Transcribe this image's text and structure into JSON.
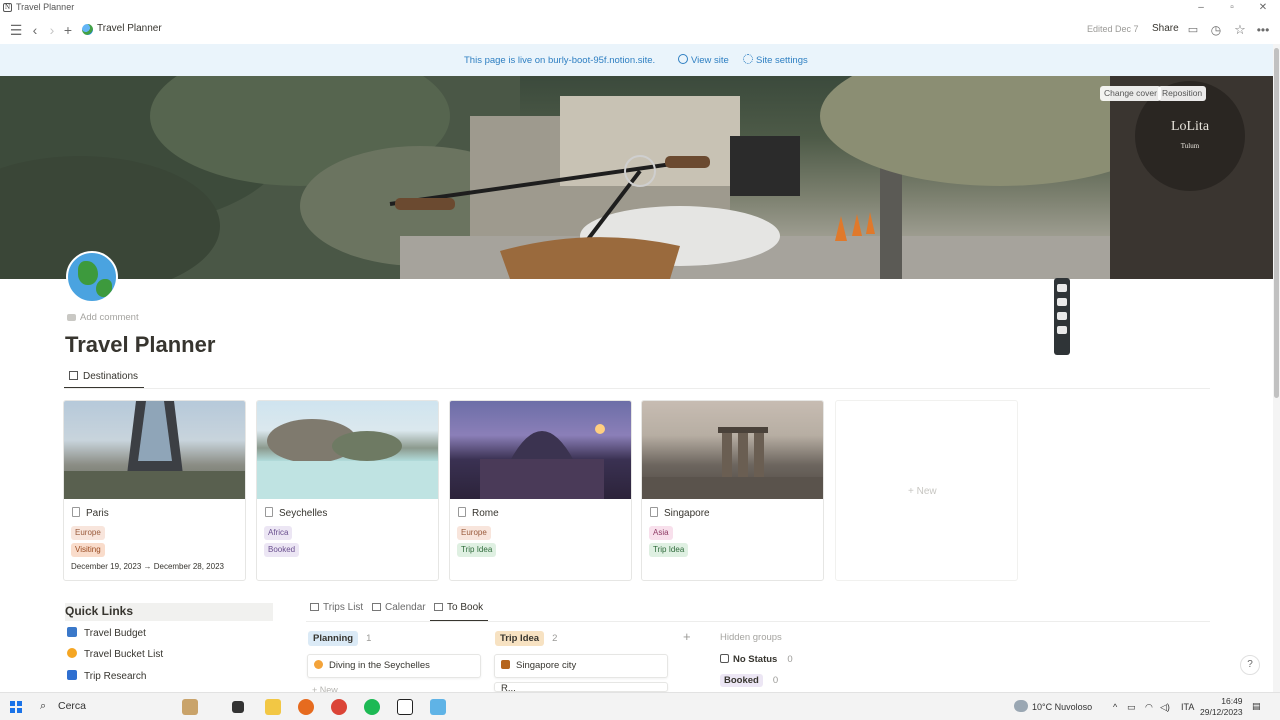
{
  "window": {
    "title": "Travel Planner",
    "app_glyph": "N"
  },
  "topbar": {
    "breadcrumb": "Travel Planner",
    "edited": "Edited Dec 7",
    "share": "Share"
  },
  "banner": {
    "live_text": "This page is live on burly-boot-95f.notion.site.",
    "view_site": "View site",
    "site_settings": "Site settings"
  },
  "cover": {
    "change_cover": "Change cover",
    "reposition": "Reposition"
  },
  "page": {
    "add_comment": "Add comment",
    "title": "Travel Planner"
  },
  "gallery": {
    "tab": "Destinations",
    "new_label": "+ New",
    "cards": [
      {
        "name": "Paris",
        "tags": [
          {
            "text": "Europe",
            "bg": "#f8e5dc",
            "fg": "#9a5b3c"
          },
          {
            "text": "Visiting",
            "bg": "#f9dccb",
            "fg": "#9a4a20"
          }
        ],
        "dates": "December 19, 2023 → December 28, 2023"
      },
      {
        "name": "Seychelles",
        "tags": [
          {
            "text": "Africa",
            "bg": "#ece6f4",
            "fg": "#6a4f8f"
          },
          {
            "text": "Booked",
            "bg": "#ece6f4",
            "fg": "#6a4f8f"
          }
        ],
        "dates": ""
      },
      {
        "name": "Rome",
        "tags": [
          {
            "text": "Europe",
            "bg": "#f8e5dc",
            "fg": "#9a5b3c"
          },
          {
            "text": "Trip Idea",
            "bg": "#dff0e2",
            "fg": "#2f6b3b"
          }
        ],
        "dates": ""
      },
      {
        "name": "Singapore",
        "tags": [
          {
            "text": "Asia",
            "bg": "#f8e0ec",
            "fg": "#8f3d66"
          },
          {
            "text": "Trip Idea",
            "bg": "#dff0e2",
            "fg": "#2f6b3b"
          }
        ],
        "dates": ""
      }
    ]
  },
  "quick_links": {
    "title": "Quick Links",
    "items": [
      {
        "label": "Travel Budget",
        "color": "#3a78c9"
      },
      {
        "label": "Travel Bucket List",
        "color": "#f5a623"
      },
      {
        "label": "Trip Research",
        "color": "#2f6fd0"
      }
    ]
  },
  "board": {
    "tabs": [
      "Trips List",
      "Calendar",
      "To Book"
    ],
    "groups": [
      {
        "name": "Planning",
        "count": "1",
        "bg": "#dbeaf6",
        "card": "Diving in the Seychelles",
        "emoji_color": "#f3a33a",
        "new": "+ New"
      },
      {
        "name": "Trip Idea",
        "count": "2",
        "bg": "#f7e2c2",
        "card": "Singapore city",
        "emoji_color": "#b5651d",
        "card2": "R..."
      }
    ],
    "add_group": "+",
    "hidden_groups_label": "Hidden groups",
    "hidden": [
      {
        "name": "No Status",
        "count": "0"
      },
      {
        "name": "Booked",
        "count": "0"
      }
    ]
  },
  "help": "?",
  "taskbar": {
    "search": "Cerca",
    "weather": "10°C  Nuvoloso",
    "lang": "ITA",
    "time": "16:49",
    "date": "29/12/2023"
  }
}
